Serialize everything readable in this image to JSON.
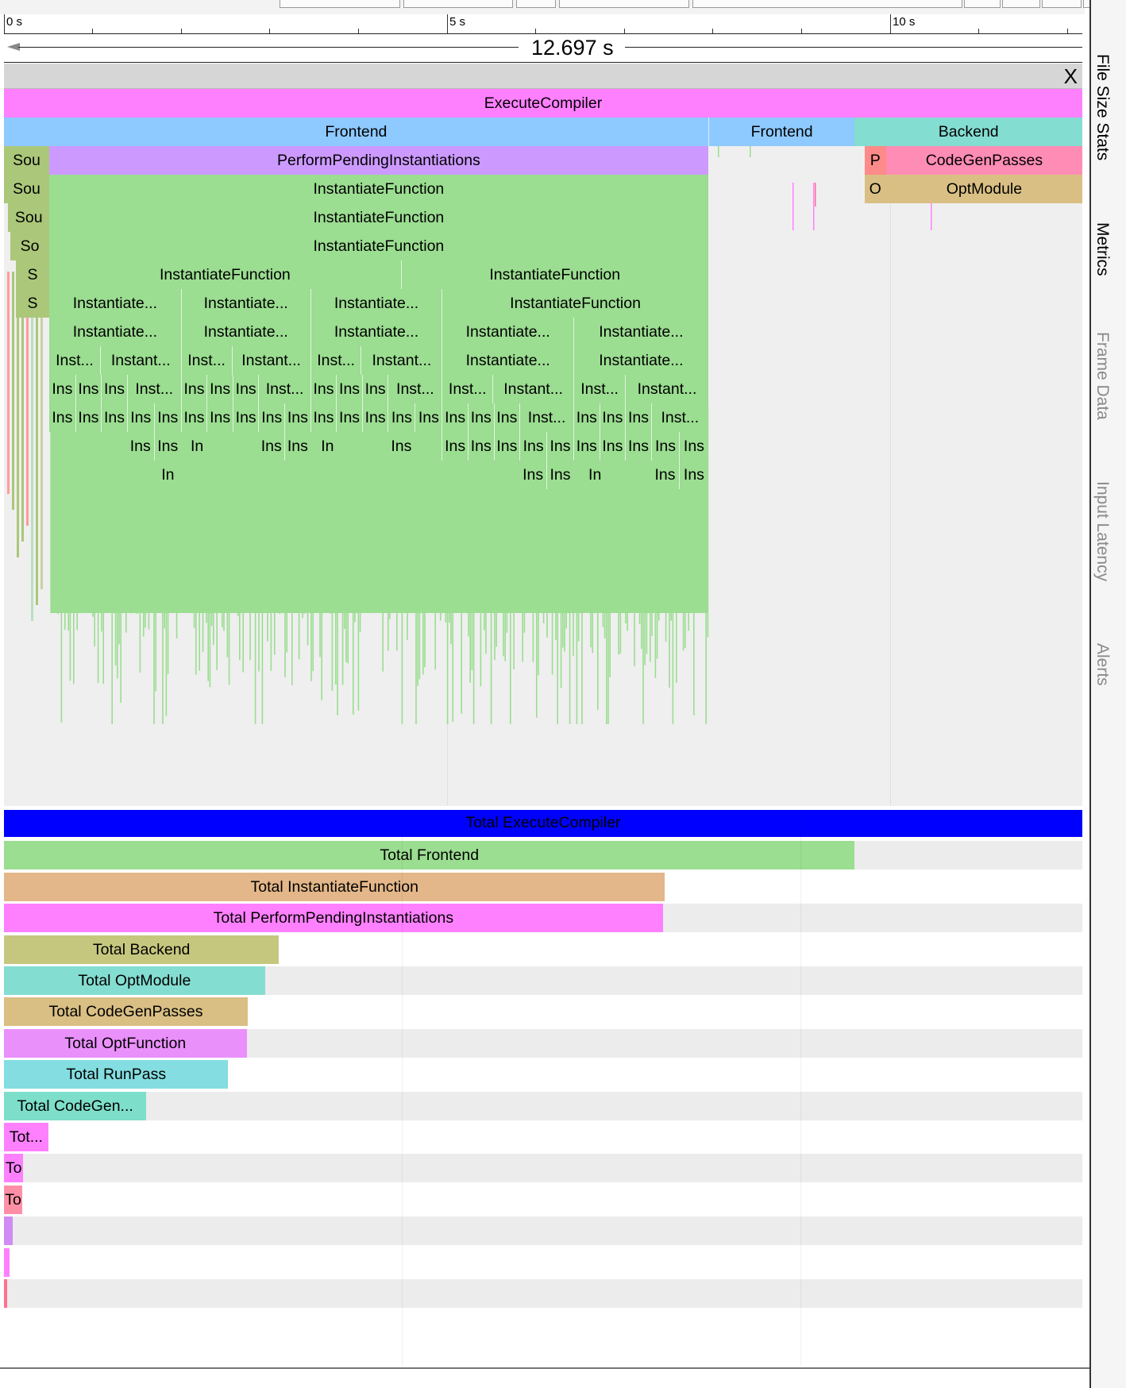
{
  "ruler": {
    "labels": [
      "0 s",
      "5 s",
      "10 s"
    ],
    "duration": "12.697 s"
  },
  "track_header": {
    "close_label": "X"
  },
  "colors": {
    "pink": "#ff80ff",
    "blue": "#8ec9ff",
    "teal": "#84ddd1",
    "purple": "#cc99ff",
    "green": "#9bdd91",
    "olive": "#abc77a",
    "salmon": "#ff8a8a",
    "rose": "#ff8cb4",
    "tan": "#d9bf84",
    "navy": "#0000ff"
  },
  "flame": [
    {
      "row": 0,
      "x": 0,
      "w": 100,
      "label": "ExecuteCompiler",
      "c": "pink"
    },
    {
      "row": 1,
      "x": 0,
      "w": 65.3,
      "label": "Frontend",
      "c": "blue"
    },
    {
      "row": 1,
      "x": 65.3,
      "w": 13.6,
      "label": "Frontend",
      "c": "blue",
      "sep": true
    },
    {
      "row": 1,
      "x": 78.9,
      "w": 21.1,
      "label": "Backend",
      "c": "teal"
    },
    {
      "row": 2,
      "x": 0,
      "w": 4.2,
      "label": "Sou",
      "c": "olive"
    },
    {
      "row": 2,
      "x": 4.2,
      "w": 61.1,
      "label": "PerformPendingInstantiations",
      "c": "purple"
    },
    {
      "row": 2,
      "x": 79.8,
      "w": 2.0,
      "label": "P",
      "c": "salmon"
    },
    {
      "row": 2,
      "x": 81.8,
      "w": 18.2,
      "label": "CodeGenPasses",
      "c": "rose"
    },
    {
      "row": 3,
      "x": 0,
      "w": 4.2,
      "label": "Sou",
      "c": "olive"
    },
    {
      "row": 3,
      "x": 4.2,
      "w": 61.1,
      "label": "InstantiateFunction",
      "c": "green"
    },
    {
      "row": 3,
      "x": 79.8,
      "w": 2.0,
      "label": "O",
      "c": "tan"
    },
    {
      "row": 3,
      "x": 81.8,
      "w": 18.2,
      "label": "OptModule",
      "c": "tan"
    },
    {
      "row": 4,
      "x": 0.4,
      "w": 3.8,
      "label": "Sou",
      "c": "olive"
    },
    {
      "row": 4,
      "x": 4.2,
      "w": 61.1,
      "label": "InstantiateFunction",
      "c": "green"
    },
    {
      "row": 5,
      "x": 0.6,
      "w": 3.6,
      "label": "So",
      "c": "olive"
    },
    {
      "row": 5,
      "x": 4.2,
      "w": 61.1,
      "label": "InstantiateFunction",
      "c": "green"
    },
    {
      "row": 6,
      "x": 1.1,
      "w": 3.1,
      "label": "S",
      "c": "olive"
    },
    {
      "row": 6,
      "x": 4.2,
      "w": 32.6,
      "label": "InstantiateFunction",
      "c": "green"
    },
    {
      "row": 6,
      "x": 36.8,
      "w": 28.5,
      "label": "InstantiateFunction",
      "c": "green",
      "sep": true
    },
    {
      "row": 7,
      "x": 1.1,
      "w": 3.1,
      "label": "S",
      "c": "olive"
    },
    {
      "row": 7,
      "x": 4.2,
      "w": 12.2,
      "label": "Instantiate...",
      "c": "green"
    },
    {
      "row": 7,
      "x": 16.4,
      "w": 12.0,
      "label": "Instantiate...",
      "c": "green",
      "sep": true
    },
    {
      "row": 7,
      "x": 28.4,
      "w": 12.2,
      "label": "Instantiate...",
      "c": "green",
      "sep": true
    },
    {
      "row": 7,
      "x": 40.6,
      "w": 24.7,
      "label": "InstantiateFunction",
      "c": "green",
      "sep": true
    },
    {
      "row": 8,
      "x": 4.2,
      "w": 12.2,
      "label": "Instantiate...",
      "c": "green"
    },
    {
      "row": 8,
      "x": 16.4,
      "w": 12.0,
      "label": "Instantiate...",
      "c": "green",
      "sep": true
    },
    {
      "row": 8,
      "x": 28.4,
      "w": 12.2,
      "label": "Instantiate...",
      "c": "green",
      "sep": true
    },
    {
      "row": 8,
      "x": 40.6,
      "w": 12.2,
      "label": "Instantiate...",
      "c": "green",
      "sep": true
    },
    {
      "row": 8,
      "x": 52.8,
      "w": 12.5,
      "label": "Instantiate...",
      "c": "green",
      "sep": true
    },
    {
      "row": 9,
      "x": 4.2,
      "w": 4.7,
      "label": "Inst...",
      "c": "green"
    },
    {
      "row": 9,
      "x": 8.9,
      "w": 7.5,
      "label": "Instant...",
      "c": "green",
      "sep": true
    },
    {
      "row": 9,
      "x": 16.4,
      "w": 4.7,
      "label": "Inst...",
      "c": "green",
      "sep": true
    },
    {
      "row": 9,
      "x": 21.1,
      "w": 7.3,
      "label": "Instant...",
      "c": "green",
      "sep": true
    },
    {
      "row": 9,
      "x": 28.4,
      "w": 4.7,
      "label": "Inst...",
      "c": "green",
      "sep": true
    },
    {
      "row": 9,
      "x": 33.1,
      "w": 7.5,
      "label": "Instant...",
      "c": "green",
      "sep": true
    },
    {
      "row": 9,
      "x": 40.6,
      "w": 12.2,
      "label": "Instantiate...",
      "c": "green",
      "sep": true
    },
    {
      "row": 9,
      "x": 52.8,
      "w": 12.5,
      "label": "Instantiate...",
      "c": "green",
      "sep": true
    },
    {
      "row": 10,
      "x": 4.2,
      "w": 2.4,
      "label": "Ins",
      "c": "green"
    },
    {
      "row": 10,
      "x": 6.6,
      "w": 2.4,
      "label": "Ins",
      "c": "green",
      "sep": true
    },
    {
      "row": 10,
      "x": 9.0,
      "w": 2.4,
      "label": "Ins",
      "c": "green",
      "sep": true
    },
    {
      "row": 10,
      "x": 11.4,
      "w": 5.0,
      "label": "Inst...",
      "c": "green",
      "sep": true
    },
    {
      "row": 10,
      "x": 16.4,
      "w": 2.4,
      "label": "Ins",
      "c": "green",
      "sep": true
    },
    {
      "row": 10,
      "x": 18.8,
      "w": 2.4,
      "label": "Ins",
      "c": "green",
      "sep": true
    },
    {
      "row": 10,
      "x": 21.2,
      "w": 2.4,
      "label": "Ins",
      "c": "green",
      "sep": true
    },
    {
      "row": 10,
      "x": 23.6,
      "w": 4.8,
      "label": "Inst...",
      "c": "green",
      "sep": true
    },
    {
      "row": 10,
      "x": 28.4,
      "w": 2.4,
      "label": "Ins",
      "c": "green",
      "sep": true
    },
    {
      "row": 10,
      "x": 30.8,
      "w": 2.4,
      "label": "Ins",
      "c": "green",
      "sep": true
    },
    {
      "row": 10,
      "x": 33.2,
      "w": 2.4,
      "label": "Ins",
      "c": "green",
      "sep": true
    },
    {
      "row": 10,
      "x": 35.6,
      "w": 5.0,
      "label": "Inst...",
      "c": "green",
      "sep": true
    },
    {
      "row": 10,
      "x": 40.6,
      "w": 4.7,
      "label": "Inst...",
      "c": "green",
      "sep": true
    },
    {
      "row": 10,
      "x": 45.3,
      "w": 7.5,
      "label": "Instant...",
      "c": "green",
      "sep": true
    },
    {
      "row": 10,
      "x": 52.8,
      "w": 4.8,
      "label": "Inst...",
      "c": "green",
      "sep": true
    },
    {
      "row": 10,
      "x": 57.6,
      "w": 7.7,
      "label": "Instant...",
      "c": "green",
      "sep": true
    },
    {
      "row": 11,
      "x": 4.2,
      "w": 2.4,
      "label": "Ins",
      "c": "green"
    },
    {
      "row": 11,
      "x": 6.6,
      "w": 2.4,
      "label": "Ins",
      "c": "green",
      "sep": true
    },
    {
      "row": 11,
      "x": 9.0,
      "w": 2.4,
      "label": "Ins",
      "c": "green",
      "sep": true
    },
    {
      "row": 11,
      "x": 11.4,
      "w": 2.5,
      "label": "Ins",
      "c": "green",
      "sep": true
    },
    {
      "row": 11,
      "x": 13.9,
      "w": 2.5,
      "label": "Ins",
      "c": "green",
      "sep": true
    },
    {
      "row": 11,
      "x": 16.4,
      "w": 2.4,
      "label": "Ins",
      "c": "green",
      "sep": true
    },
    {
      "row": 11,
      "x": 18.8,
      "w": 2.4,
      "label": "Ins",
      "c": "green",
      "sep": true
    },
    {
      "row": 11,
      "x": 21.2,
      "w": 2.4,
      "label": "Ins",
      "c": "green",
      "sep": true
    },
    {
      "row": 11,
      "x": 23.6,
      "w": 2.4,
      "label": "Ins",
      "c": "green",
      "sep": true
    },
    {
      "row": 11,
      "x": 26.0,
      "w": 2.4,
      "label": "Ins",
      "c": "green",
      "sep": true
    },
    {
      "row": 11,
      "x": 28.4,
      "w": 2.4,
      "label": "Ins",
      "c": "green",
      "sep": true
    },
    {
      "row": 11,
      "x": 30.8,
      "w": 2.4,
      "label": "Ins",
      "c": "green",
      "sep": true
    },
    {
      "row": 11,
      "x": 33.2,
      "w": 2.4,
      "label": "Ins",
      "c": "green",
      "sep": true
    },
    {
      "row": 11,
      "x": 35.6,
      "w": 2.5,
      "label": "Ins",
      "c": "green",
      "sep": true
    },
    {
      "row": 11,
      "x": 38.1,
      "w": 2.5,
      "label": "Ins",
      "c": "green",
      "sep": true
    },
    {
      "row": 11,
      "x": 40.6,
      "w": 2.4,
      "label": "Ins",
      "c": "green",
      "sep": true
    },
    {
      "row": 11,
      "x": 43.0,
      "w": 2.4,
      "label": "Ins",
      "c": "green",
      "sep": true
    },
    {
      "row": 11,
      "x": 45.4,
      "w": 2.4,
      "label": "Ins",
      "c": "green",
      "sep": true
    },
    {
      "row": 11,
      "x": 47.8,
      "w": 5.0,
      "label": "Inst...",
      "c": "green",
      "sep": true
    },
    {
      "row": 11,
      "x": 52.8,
      "w": 2.4,
      "label": "Ins",
      "c": "green",
      "sep": true
    },
    {
      "row": 11,
      "x": 55.2,
      "w": 2.4,
      "label": "Ins",
      "c": "green",
      "sep": true
    },
    {
      "row": 11,
      "x": 57.6,
      "w": 2.4,
      "label": "Ins",
      "c": "green",
      "sep": true
    },
    {
      "row": 11,
      "x": 60.0,
      "w": 5.3,
      "label": "Inst...",
      "c": "green",
      "sep": true
    },
    {
      "row": 12,
      "x": 11.4,
      "w": 2.5,
      "label": "Ins",
      "c": "green"
    },
    {
      "row": 12,
      "x": 13.9,
      "w": 2.5,
      "label": "Ins",
      "c": "green",
      "sep": true
    },
    {
      "row": 12,
      "x": 16.9,
      "w": 2.0,
      "label": "In",
      "c": "green"
    },
    {
      "row": 12,
      "x": 23.6,
      "w": 2.4,
      "label": "Ins",
      "c": "green"
    },
    {
      "row": 12,
      "x": 26.0,
      "w": 2.4,
      "label": "Ins",
      "c": "green",
      "sep": true
    },
    {
      "row": 12,
      "x": 29.0,
      "w": 2.0,
      "label": "In",
      "c": "green"
    },
    {
      "row": 12,
      "x": 35.6,
      "w": 2.5,
      "label": "Ins",
      "c": "green"
    },
    {
      "row": 12,
      "x": 40.6,
      "w": 2.4,
      "label": "Ins",
      "c": "green",
      "sep": true
    },
    {
      "row": 12,
      "x": 43.0,
      "w": 2.4,
      "label": "Ins",
      "c": "green",
      "sep": true
    },
    {
      "row": 12,
      "x": 45.4,
      "w": 2.4,
      "label": "Ins",
      "c": "green",
      "sep": true
    },
    {
      "row": 12,
      "x": 47.8,
      "w": 2.5,
      "label": "Ins",
      "c": "green",
      "sep": true
    },
    {
      "row": 12,
      "x": 50.3,
      "w": 2.5,
      "label": "Ins",
      "c": "green",
      "sep": true
    },
    {
      "row": 12,
      "x": 52.8,
      "w": 2.4,
      "label": "Ins",
      "c": "green",
      "sep": true
    },
    {
      "row": 12,
      "x": 55.2,
      "w": 2.4,
      "label": "Ins",
      "c": "green",
      "sep": true
    },
    {
      "row": 12,
      "x": 57.6,
      "w": 2.4,
      "label": "Ins",
      "c": "green",
      "sep": true
    },
    {
      "row": 12,
      "x": 60.0,
      "w": 2.6,
      "label": "Ins",
      "c": "green",
      "sep": true
    },
    {
      "row": 12,
      "x": 62.6,
      "w": 2.7,
      "label": "Ins",
      "c": "green",
      "sep": true
    },
    {
      "row": 13,
      "x": 14.2,
      "w": 2.0,
      "label": "In",
      "c": "green"
    },
    {
      "row": 13,
      "x": 47.8,
      "w": 2.5,
      "label": "Ins",
      "c": "green"
    },
    {
      "row": 13,
      "x": 50.3,
      "w": 2.5,
      "label": "Ins",
      "c": "green",
      "sep": true
    },
    {
      "row": 13,
      "x": 53.8,
      "w": 2.0,
      "label": "In",
      "c": "green"
    },
    {
      "row": 13,
      "x": 60.0,
      "w": 2.6,
      "label": "Ins",
      "c": "green"
    },
    {
      "row": 13,
      "x": 62.6,
      "w": 2.7,
      "label": "Ins",
      "c": "green",
      "sep": true
    }
  ],
  "totals": [
    {
      "label": "Total ExecuteCompiler",
      "pct": 100,
      "c": "#0000ff"
    },
    {
      "label": "Total Frontend",
      "pct": 78.9,
      "c": "#9bdd91"
    },
    {
      "label": "Total InstantiateFunction",
      "pct": 61.3,
      "c": "#e3b789"
    },
    {
      "label": "Total PerformPendingInstantiations",
      "pct": 61.1,
      "c": "#ff80ff"
    },
    {
      "label": "Total Backend",
      "pct": 25.5,
      "c": "#c6c77f"
    },
    {
      "label": "Total OptModule",
      "pct": 24.2,
      "c": "#84ddd1"
    },
    {
      "label": "Total CodeGenPasses",
      "pct": 22.6,
      "c": "#d9bf84"
    },
    {
      "label": "Total OptFunction",
      "pct": 22.5,
      "c": "#ea90fb"
    },
    {
      "label": "Total RunPass",
      "pct": 20.8,
      "c": "#84dde0"
    },
    {
      "label": "Total CodeGen...",
      "pct": 13.2,
      "c": "#7ddfca"
    },
    {
      "label": "Tot...",
      "pct": 4.1,
      "c": "#ff80ff"
    },
    {
      "label": "To",
      "pct": 1.8,
      "c": "#ff80ff"
    },
    {
      "label": "To",
      "pct": 1.7,
      "c": "#ff8fa6"
    },
    {
      "label": "",
      "pct": 0.8,
      "c": "#d08cf2"
    },
    {
      "label": "",
      "pct": 0.5,
      "c": "#ff80ff"
    },
    {
      "label": "",
      "pct": 0.3,
      "c": "#ff7090"
    }
  ],
  "sidebar": {
    "tabs": [
      "File Size Stats",
      "Metrics",
      "Frame Data",
      "Input Latency",
      "Alerts"
    ]
  }
}
